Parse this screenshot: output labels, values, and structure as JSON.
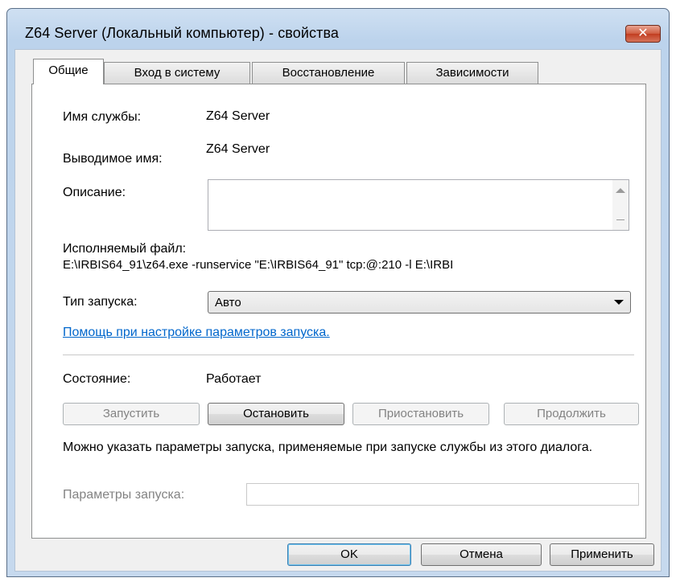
{
  "window": {
    "title": "Z64 Server (Локальный компьютер) - свойства",
    "close_label": "✕"
  },
  "tabs": [
    {
      "label": "Общие",
      "active": true
    },
    {
      "label": "Вход в систему",
      "active": false
    },
    {
      "label": "Восстановление",
      "active": false
    },
    {
      "label": "Зависимости",
      "active": false
    }
  ],
  "general": {
    "service_name_label": "Имя службы:",
    "service_name_value": "Z64 Server",
    "display_name_label": "Выводимое имя:",
    "display_name_value": "Z64 Server",
    "description_label": "Описание:",
    "description_value": "",
    "executable_label": "Исполняемый файл:",
    "executable_value": "E:\\IRBIS64_91\\z64.exe -runservice \"E:\\IRBIS64_91\" tcp:@:210 -l E:\\IRBI",
    "startup_type_label": "Тип запуска:",
    "startup_type_value": "Авто",
    "help_link": "Помощь при настройке параметров запуска.",
    "status_label": "Состояние:",
    "status_value": "Работает",
    "buttons": {
      "start": "Запустить",
      "stop": "Остановить",
      "pause": "Приостановить",
      "resume": "Продолжить"
    },
    "note": "Можно указать параметры запуска, применяемые при запуске службы из этого диалога.",
    "params_label": "Параметры запуска:",
    "params_value": ""
  },
  "footer": {
    "ok": "OK",
    "cancel": "Отмена",
    "apply": "Применить"
  }
}
